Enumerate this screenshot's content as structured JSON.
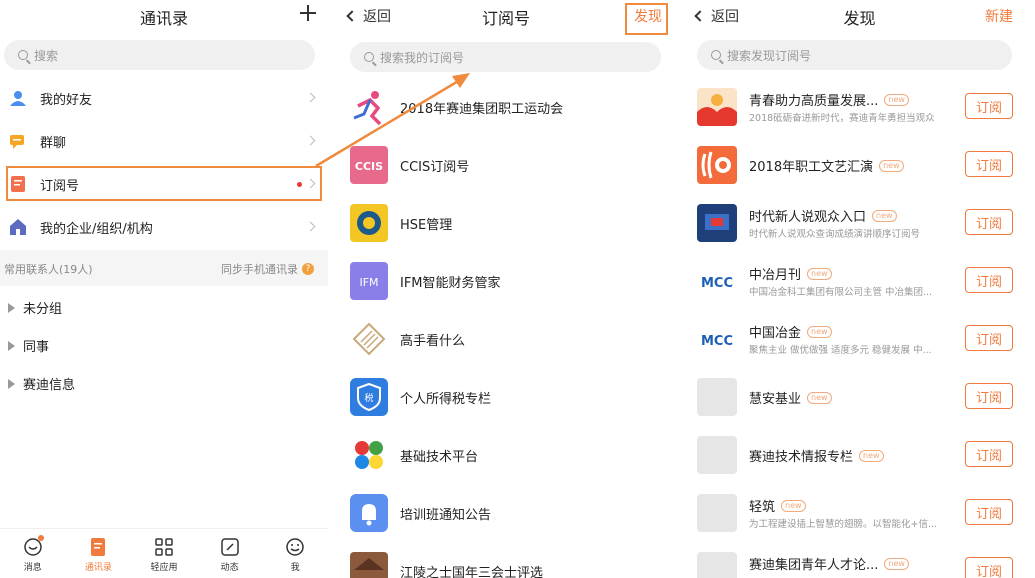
{
  "contacts": {
    "title": "通讯录",
    "search_placeholder": "搜索",
    "items": [
      {
        "label": "我的好友",
        "icon": "person-icon"
      },
      {
        "label": "群聊",
        "icon": "chat-group-icon"
      },
      {
        "label": "订阅号",
        "icon": "subscription-icon"
      },
      {
        "label": "我的企业/组织/机构",
        "icon": "house-icon"
      }
    ],
    "frequent_label": "常用联系人(19人)",
    "sync_label": "同步手机通讯录",
    "groups": [
      "未分组",
      "同事",
      "赛迪信息"
    ],
    "tabs": [
      {
        "label": "消息",
        "icon": "message-icon"
      },
      {
        "label": "通讯录",
        "icon": "contacts-icon"
      },
      {
        "label": "轻应用",
        "icon": "apps-grid-icon"
      },
      {
        "label": "动态",
        "icon": "edit-icon"
      },
      {
        "label": "我",
        "icon": "smile-icon"
      }
    ]
  },
  "subscriptions": {
    "back_label": "返回",
    "title": "订阅号",
    "discover_label": "发现",
    "search_placeholder": "搜索我的订阅号",
    "items": [
      {
        "name": "2018年赛迪集团职工运动会"
      },
      {
        "name": "CCIS订阅号"
      },
      {
        "name": "HSE管理"
      },
      {
        "name": "IFM智能财务管家"
      },
      {
        "name": "高手看什么"
      },
      {
        "name": "个人所得税专栏"
      },
      {
        "name": "基础技术平台"
      },
      {
        "name": "培训班通知公告"
      },
      {
        "name": "江陵之士国年三会士评选"
      }
    ]
  },
  "discover": {
    "back_label": "返回",
    "title": "发现",
    "new_label": "新建",
    "search_placeholder": "搜索发现订阅号",
    "badge": "new",
    "subscribe_label": "订阅",
    "items": [
      {
        "title": "青春助力高质量发展...",
        "desc": "2018砥砺奋进新时代，赛迪青年勇担当观众"
      },
      {
        "title": "2018年职工文艺汇演",
        "desc": ""
      },
      {
        "title": "时代新人说观众入口",
        "desc": "时代新人说观众查询成绩演讲顺序订阅号"
      },
      {
        "title": "中冶月刊",
        "desc": "中国冶金科工集团有限公司主管 中冶集团..."
      },
      {
        "title": "中国冶金",
        "desc": "聚焦主业 做优做强 适度多元 稳健发展 中..."
      },
      {
        "title": "慧安基业",
        "desc": ""
      },
      {
        "title": "赛迪技术情报专栏",
        "desc": ""
      },
      {
        "title": "轻筑",
        "desc": "为工程建设插上智慧的翅膀。以智能化+信..."
      },
      {
        "title": "赛迪集团青年人才论...",
        "desc": ""
      }
    ]
  },
  "colors": {
    "accent": "#f07b3c",
    "highlight": "#f08a3c"
  }
}
